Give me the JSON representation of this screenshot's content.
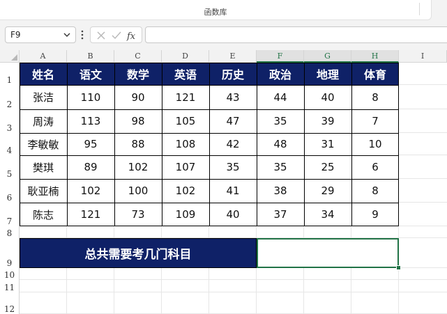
{
  "ribbon": {
    "group_label": "函数库"
  },
  "formula_bar": {
    "name_box": "F9",
    "cancel_icon": "x-icon",
    "enter_icon": "check-icon",
    "function_icon": "fx-icon",
    "formula": ""
  },
  "columns": [
    "A",
    "B",
    "C",
    "D",
    "E",
    "F",
    "G",
    "H",
    "I"
  ],
  "selected_columns": [
    "F",
    "G",
    "H"
  ],
  "rows": [
    "1",
    "2",
    "3",
    "4",
    "5",
    "6",
    "7",
    "8",
    "9",
    "10",
    "11",
    "12"
  ],
  "table": {
    "headers": [
      "姓名",
      "语文",
      "数学",
      "英语",
      "历史",
      "政治",
      "地理",
      "体育"
    ],
    "rows": [
      [
        "张洁",
        "110",
        "90",
        "121",
        "43",
        "44",
        "40",
        "8"
      ],
      [
        "周涛",
        "113",
        "98",
        "105",
        "47",
        "35",
        "39",
        "7"
      ],
      [
        "李敏敏",
        "95",
        "88",
        "108",
        "42",
        "48",
        "31",
        "10"
      ],
      [
        "樊琪",
        "89",
        "102",
        "107",
        "35",
        "35",
        "25",
        "6"
      ],
      [
        "耿亚楠",
        "102",
        "100",
        "102",
        "41",
        "38",
        "29",
        "8"
      ],
      [
        "陈志",
        "121",
        "73",
        "109",
        "40",
        "37",
        "34",
        "9"
      ]
    ]
  },
  "summary": {
    "label": "总共需要考几门科目",
    "answer": ""
  },
  "colors": {
    "header_fill": "#0f2167",
    "selection": "#217346"
  }
}
